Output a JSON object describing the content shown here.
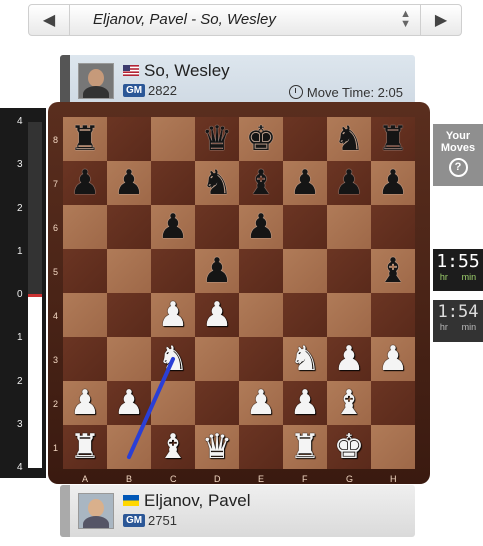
{
  "selector": {
    "title": "Eljanov, Pavel - So, Wesley",
    "prev_icon": "chevron-left-icon",
    "next_icon": "chevron-right-icon"
  },
  "top_player": {
    "name": "So, Wesley",
    "flag": "US",
    "title": "GM",
    "rating": "2822",
    "move_time_label": "Move Time: 2:05"
  },
  "bottom_player": {
    "name": "Eljanov, Pavel",
    "flag": "UA",
    "title": "GM",
    "rating": "2751"
  },
  "eval_bar": {
    "ticks": [
      "4",
      "3",
      "2",
      "1",
      "0",
      "1",
      "2",
      "3",
      "4"
    ],
    "value": 0
  },
  "side_panel": {
    "your_moves_line1": "Your",
    "your_moves_line2": "Moves",
    "help_icon": "?"
  },
  "clocks": [
    {
      "time": "1:55",
      "hr": "hr",
      "min": "min",
      "state": "active"
    },
    {
      "time": "1:54",
      "hr": "hr",
      "min": "min",
      "state": "idle"
    }
  ],
  "board": {
    "ranks": [
      "8",
      "7",
      "6",
      "5",
      "4",
      "3",
      "2",
      "1"
    ],
    "files": [
      "A",
      "B",
      "C",
      "D",
      "E",
      "F",
      "G",
      "H"
    ],
    "rows": [
      [
        "bR",
        "",
        "",
        "bQ",
        "bK",
        "",
        "bN",
        "bR"
      ],
      [
        "bP",
        "bP",
        "",
        "bN",
        "bB",
        "bP",
        "bP",
        "bP"
      ],
      [
        "",
        "",
        "bP",
        "",
        "bP",
        "",
        "",
        ""
      ],
      [
        "",
        "",
        "",
        "bP",
        "",
        "",
        "",
        "bB"
      ],
      [
        "",
        "",
        "wP",
        "wP",
        "",
        "",
        "",
        ""
      ],
      [
        "",
        "",
        "wN",
        "",
        "",
        "wN",
        "wP",
        "wP"
      ],
      [
        "wP",
        "wP",
        "",
        "",
        "wP",
        "wP",
        "wB",
        ""
      ],
      [
        "wR",
        "",
        "wB",
        "wQ",
        "",
        "wR",
        "wK",
        ""
      ]
    ],
    "arrow": {
      "from": "b1",
      "to": "c3",
      "color": "#2a3fd6"
    }
  },
  "colors": {
    "frame": "#4a2416",
    "light_square": "#a87354",
    "dark_square": "#62301f",
    "gm_badge": "#2b5797"
  }
}
